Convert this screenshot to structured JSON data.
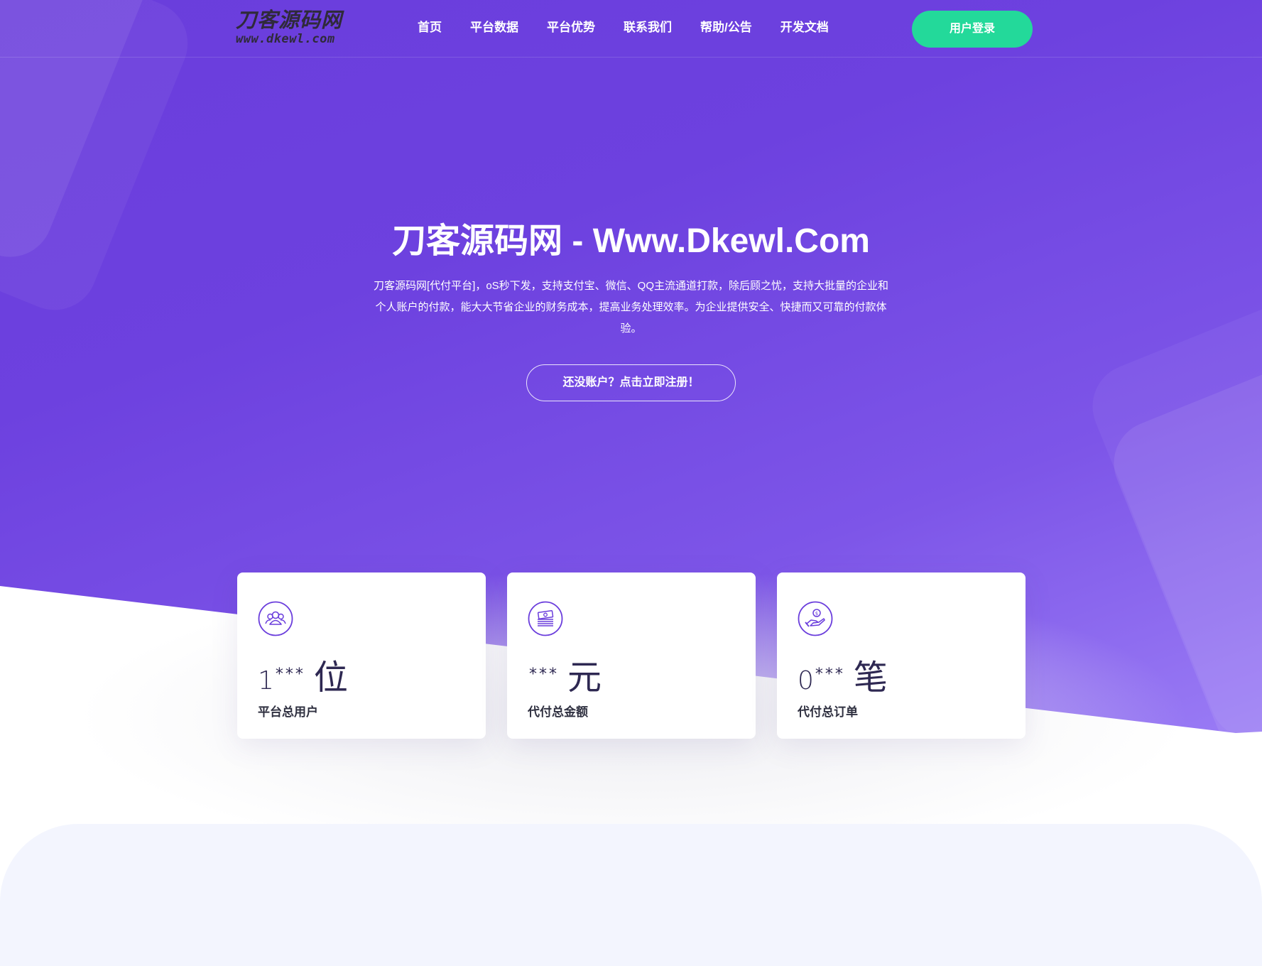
{
  "logo": {
    "title": "刀客源码网",
    "subtitle": "www.dkewl.com"
  },
  "nav": {
    "items": [
      {
        "label": "首页"
      },
      {
        "label": "平台数据"
      },
      {
        "label": "平台优势"
      },
      {
        "label": "联系我们"
      },
      {
        "label": "帮助/公告"
      },
      {
        "label": "开发文档"
      }
    ],
    "login_label": "用户登录"
  },
  "hero": {
    "title": "刀客源码网 - Www.Dkewl.Com",
    "description": "刀客源码网[代付平台]，oS秒下发，支持支付宝、微信、QQ主流通道打款，除后顾之忧，支持大批量的企业和个人账户的付款，能大大节省企业的财务成本，提高业务处理效率。为企业提供安全、快捷而又可靠的付款体验。",
    "register_label": "还没账户？点击立即注册！"
  },
  "stats": [
    {
      "icon": "users-icon",
      "value": "1",
      "mask": "***",
      "unit": "位",
      "label": "平台总用户"
    },
    {
      "icon": "money-stack-icon",
      "value": "",
      "mask": "***",
      "unit": "元",
      "label": "代付总金额"
    },
    {
      "icon": "hand-coin-icon",
      "value": "0",
      "mask": "***",
      "unit": "笔",
      "label": "代付总订单"
    }
  ],
  "colors": {
    "hero_gradient_start": "#6a3ddc",
    "hero_gradient_end": "#9a7cf5",
    "accent_green": "#23d99a",
    "icon_purple": "#6a3ddc",
    "value_text": "#2e2852"
  }
}
